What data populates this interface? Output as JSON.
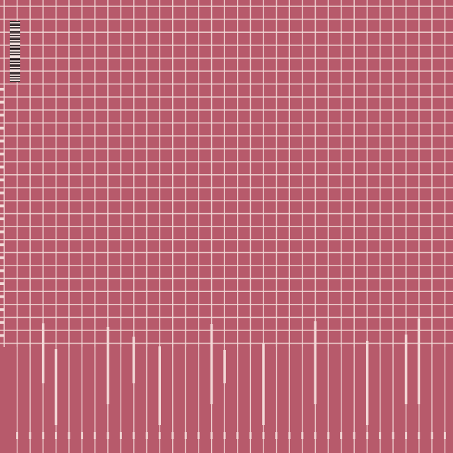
{
  "title": "",
  "colors": {
    "background": "#b75a6b",
    "grid": "#f3dad8",
    "barcode_dark": "#1c1114",
    "barcode_light": "#f4e3e0"
  },
  "barcode": {
    "icon": "barcode-icon",
    "pattern": [
      1,
      0,
      1,
      1,
      0,
      1,
      0,
      0,
      1,
      1,
      0,
      1,
      0,
      1,
      1,
      0,
      1,
      0,
      0,
      1,
      0,
      1,
      1,
      0,
      1,
      0,
      1,
      0,
      0,
      1,
      1,
      0,
      1,
      0,
      1,
      1,
      0,
      1,
      0,
      0,
      1,
      1,
      0,
      1,
      0,
      1,
      0,
      1
    ]
  }
}
